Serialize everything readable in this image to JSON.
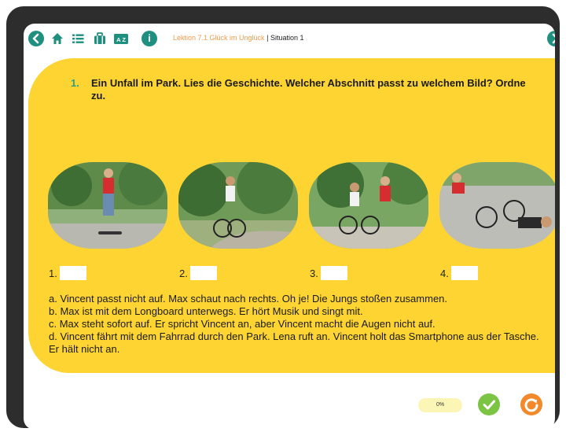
{
  "topbar": {
    "lesson": "Lektion 7.1 Glück im Unglück",
    "separator": "|",
    "situation": "Situation 1"
  },
  "task": {
    "number": "1.",
    "text": "Ein Unfall im Park. Lies die Geschichte. Welcher Abschnitt passt zu welchem Bild? Ordne zu."
  },
  "slots": [
    {
      "label": "1.",
      "value": ""
    },
    {
      "label": "2.",
      "value": ""
    },
    {
      "label": "3.",
      "value": ""
    },
    {
      "label": "4.",
      "value": ""
    }
  ],
  "paragraphs": [
    "a. Vincent passt nicht auf. Max schaut nach rechts. Oh je! Die Jungs stoßen zusammen.",
    "b. Max ist mit dem Longboard unterwegs. Er hört Musik und singt mit.",
    "c. Max steht sofort auf. Er spricht Vincent an, aber Vincent macht die Augen nicht auf.",
    "d. Vincent fährt mit dem Fahrrad durch den Park. Lena ruft an. Vincent holt das Smartphone aus der Tasche. Er hält nicht an."
  ],
  "progress": "0%",
  "colors": {
    "accent_teal": "#1f8f7f",
    "card_yellow": "#fdd431",
    "lesson_orange": "#f29b4b",
    "check_green": "#7cc443",
    "reset_orange": "#f28a2c"
  },
  "icons": [
    "back-icon",
    "home-icon",
    "list-icon",
    "bag-icon",
    "dictionary-icon",
    "info-icon",
    "forward-icon",
    "check-icon",
    "reset-icon"
  ]
}
